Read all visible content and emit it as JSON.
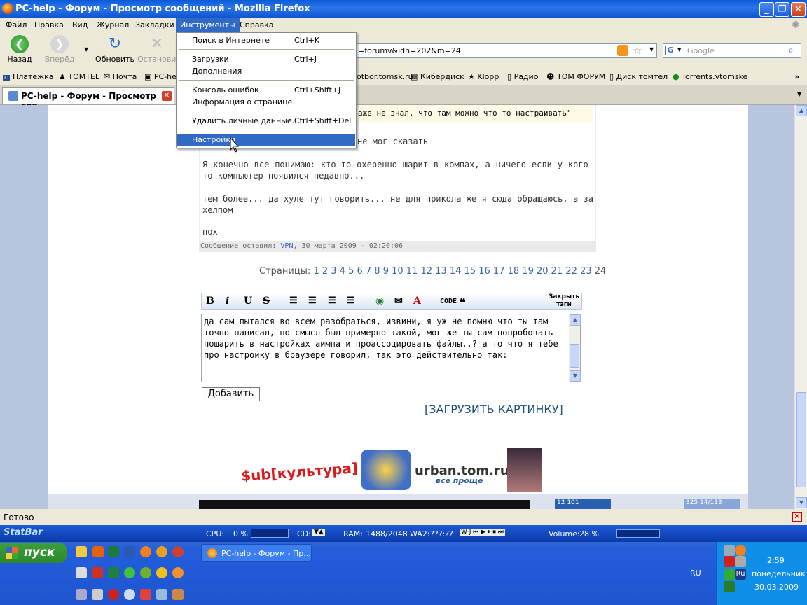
{
  "window": {
    "title": "PC-help - Форум - Просмотр сообщений - Mozilla Firefox"
  },
  "menubar": {
    "items": [
      "Файл",
      "Правка",
      "Вид",
      "Журнал",
      "Закладки",
      "Инструменты",
      "Справка"
    ]
  },
  "nav": {
    "back": "Назад",
    "forward": "Вперёд",
    "reload": "Обновить",
    "stop": "Остановить"
  },
  "url": {
    "value": "=forumv&idh=202&m=24"
  },
  "search": {
    "placeholder": "Google"
  },
  "bookmarks": [
    "Платежка",
    "TOMTEL",
    "Почта",
    "PC-he",
    "otbor.tomsk.ru",
    "Кибердиск",
    "Klopp",
    "Радио",
    "ТОМ ФОРУМ",
    "Диск томтел",
    "Torrents.vtomske"
  ],
  "tab": {
    "title": "PC-help - Форум - Просмотр соо..."
  },
  "dropdown": {
    "items": [
      {
        "label": "Поиск в Интернете",
        "shortcut": "Ctrl+K"
      },
      {
        "label": "Загрузки",
        "shortcut": "Ctrl+J"
      },
      {
        "label": "Дополнения",
        "shortcut": ""
      },
      {
        "label": "Консоль ошибок",
        "shortcut": "Ctrl+Shift+J"
      },
      {
        "label": "Информация о странице",
        "shortcut": ""
      },
      {
        "label": "Удалить личные данные...",
        "shortcut": "Ctrl+Shift+Del"
      },
      {
        "label": "Настройки",
        "shortcut": ""
      }
    ]
  },
  "post": {
    "quote": "аже не знал, что там можно что то настраивать\"",
    "line_partial": "не мог сказать",
    "p1": "Я конечно все понимаю: кто-то охеренно шарит в компах, а ничего если у кого-то компьютер появился недавно...",
    "p2": "тем более... да хуле тут говорить... не для прикола же я сюда обращаюсь, а за хелпом",
    "p3": "пох",
    "info_prefix": "Сообщение оставил:",
    "author": "VPN",
    "info_date": ", 30 марта 2009 - 02:20:06"
  },
  "pagination": {
    "label": "Страницы:",
    "pages": [
      "1",
      "2",
      "3",
      "4",
      "5",
      "6",
      "7",
      "8",
      "9",
      "10",
      "11",
      "12",
      "13",
      "14",
      "15",
      "16",
      "17",
      "18",
      "19",
      "20",
      "21",
      "22",
      "23"
    ],
    "current": "24"
  },
  "editor": {
    "close_tags": "Закрыть тэги",
    "code_label": "CODE",
    "text": "да сам пытался во всем разобраться, извини, я уж не помню что ты там точно написал, но смысл был примерно такой, мог же ты сам попробовать пошарить в настройках аимпа и проассоцировать файлы..? а то что я тебе про настройку в браузере говорил, так это действительно так:"
  },
  "add_button": "Добавить",
  "upload_link": "[ЗАГРУЗИТЬ КАРТИНКУ]",
  "banner": {
    "left": "$ub[культура]",
    "site": "urban.tom.ru",
    "slogan": "все проще"
  },
  "banner_small": {
    "a": "12 101",
    "b": "325 14/113"
  },
  "status": {
    "text": "Готово"
  },
  "statbar": {
    "brand": "StatBar",
    "cpu": "CPU:",
    "cpu_val": "0 %",
    "cd": "CD:",
    "ram": "RAM:",
    "ram_val": "1488/2048",
    "wa": "WA2:",
    "wa_val": "???:??",
    "volume": "Volume:",
    "volume_val": "28 %"
  },
  "taskbar": {
    "start": "пуск",
    "task": "PC-help - Форум - Пр...",
    "lang": "RU",
    "time": "2:59",
    "day": "понедельник",
    "date": "30.03.2009"
  },
  "colors": {
    "titlebar": "#0a5bd8",
    "menu_highlight": "#316ac5",
    "link": "#3766a8",
    "taskbar": "#245edb"
  }
}
